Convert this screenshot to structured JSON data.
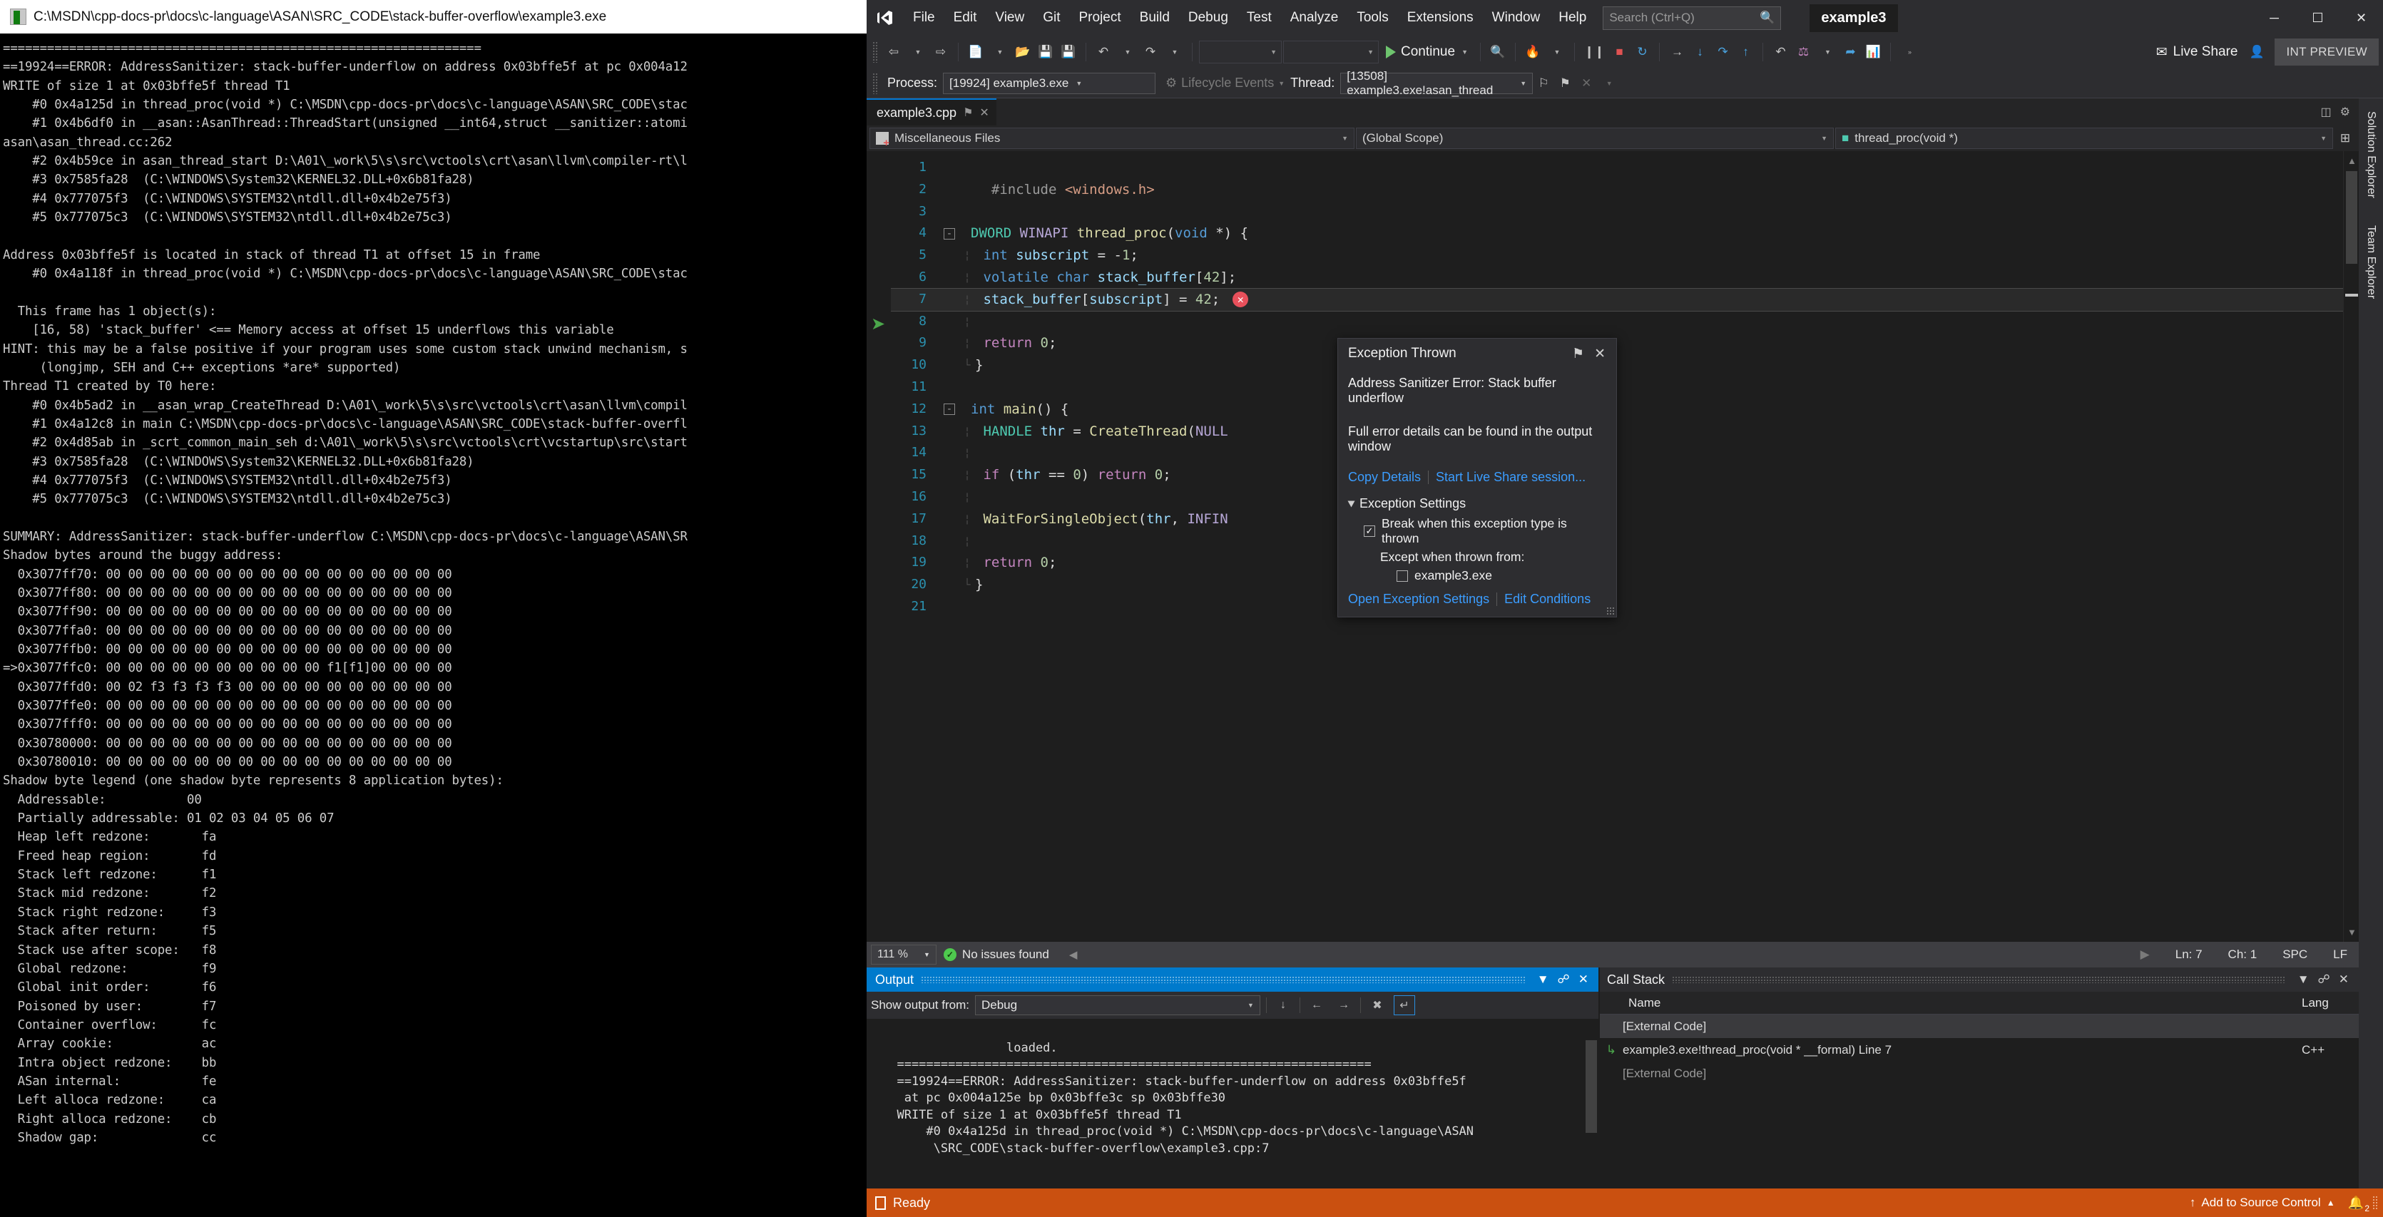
{
  "console": {
    "title": "C:\\MSDN\\cpp-docs-pr\\docs\\c-language\\ASAN\\SRC_CODE\\stack-buffer-overflow\\example3.exe",
    "text": "=================================================================\n==19924==ERROR: AddressSanitizer: stack-buffer-underflow on address 0x03bffe5f at pc 0x004a12\nWRITE of size 1 at 0x03bffe5f thread T1\n    #0 0x4a125d in thread_proc(void *) C:\\MSDN\\cpp-docs-pr\\docs\\c-language\\ASAN\\SRC_CODE\\stac\n    #1 0x4b6df0 in __asan::AsanThread::ThreadStart(unsigned __int64,struct __sanitizer::atomi\nasan\\asan_thread.cc:262\n    #2 0x4b59ce in asan_thread_start D:\\A01\\_work\\5\\s\\src\\vctools\\crt\\asan\\llvm\\compiler-rt\\l\n    #3 0x7585fa28  (C:\\WINDOWS\\System32\\KERNEL32.DLL+0x6b81fa28)\n    #4 0x777075f3  (C:\\WINDOWS\\SYSTEM32\\ntdll.dll+0x4b2e75f3)\n    #5 0x777075c3  (C:\\WINDOWS\\SYSTEM32\\ntdll.dll+0x4b2e75c3)\n\nAddress 0x03bffe5f is located in stack of thread T1 at offset 15 in frame\n    #0 0x4a118f in thread_proc(void *) C:\\MSDN\\cpp-docs-pr\\docs\\c-language\\ASAN\\SRC_CODE\\stac\n\n  This frame has 1 object(s):\n    [16, 58) 'stack_buffer' <== Memory access at offset 15 underflows this variable\nHINT: this may be a false positive if your program uses some custom stack unwind mechanism, s\n     (longjmp, SEH and C++ exceptions *are* supported)\nThread T1 created by T0 here:\n    #0 0x4b5ad2 in __asan_wrap_CreateThread D:\\A01\\_work\\5\\s\\src\\vctools\\crt\\asan\\llvm\\compil\n    #1 0x4a12c8 in main C:\\MSDN\\cpp-docs-pr\\docs\\c-language\\ASAN\\SRC_CODE\\stack-buffer-overfl\n    #2 0x4d85ab in _scrt_common_main_seh d:\\A01\\_work\\5\\s\\src\\vctools\\crt\\vcstartup\\src\\start\n    #3 0x7585fa28  (C:\\WINDOWS\\System32\\KERNEL32.DLL+0x6b81fa28)\n    #4 0x777075f3  (C:\\WINDOWS\\SYSTEM32\\ntdll.dll+0x4b2e75f3)\n    #5 0x777075c3  (C:\\WINDOWS\\SYSTEM32\\ntdll.dll+0x4b2e75c3)\n\nSUMMARY: AddressSanitizer: stack-buffer-underflow C:\\MSDN\\cpp-docs-pr\\docs\\c-language\\ASAN\\SR\nShadow bytes around the buggy address:\n  0x3077ff70: 00 00 00 00 00 00 00 00 00 00 00 00 00 00 00 00\n  0x3077ff80: 00 00 00 00 00 00 00 00 00 00 00 00 00 00 00 00\n  0x3077ff90: 00 00 00 00 00 00 00 00 00 00 00 00 00 00 00 00\n  0x3077ffa0: 00 00 00 00 00 00 00 00 00 00 00 00 00 00 00 00\n  0x3077ffb0: 00 00 00 00 00 00 00 00 00 00 00 00 00 00 00 00\n=>0x3077ffc0: 00 00 00 00 00 00 00 00 00 00 f1[f1]00 00 00 00\n  0x3077ffd0: 00 02 f3 f3 f3 f3 00 00 00 00 00 00 00 00 00 00\n  0x3077ffe0: 00 00 00 00 00 00 00 00 00 00 00 00 00 00 00 00\n  0x3077fff0: 00 00 00 00 00 00 00 00 00 00 00 00 00 00 00 00\n  0x30780000: 00 00 00 00 00 00 00 00 00 00 00 00 00 00 00 00\n  0x30780010: 00 00 00 00 00 00 00 00 00 00 00 00 00 00 00 00\nShadow byte legend (one shadow byte represents 8 application bytes):\n  Addressable:           00\n  Partially addressable: 01 02 03 04 05 06 07\n  Heap left redzone:       fa\n  Freed heap region:       fd\n  Stack left redzone:      f1\n  Stack mid redzone:       f2\n  Stack right redzone:     f3\n  Stack after return:      f5\n  Stack use after scope:   f8\n  Global redzone:          f9\n  Global init order:       f6\n  Poisoned by user:        f7\n  Container overflow:      fc\n  Array cookie:            ac\n  Intra object redzone:    bb\n  ASan internal:           fe\n  Left alloca redzone:     ca\n  Right alloca redzone:    cb\n  Shadow gap:              cc"
  },
  "vs": {
    "menus": [
      "File",
      "Edit",
      "View",
      "Git",
      "Project",
      "Build",
      "Debug",
      "Test",
      "Analyze",
      "Tools",
      "Extensions",
      "Window",
      "Help"
    ],
    "search_placeholder": "Search (Ctrl+Q)",
    "doc_title": "example3",
    "window_controls": {
      "minimize": "─",
      "maximize": "☐",
      "close": "✕"
    },
    "toolbar": {
      "continue_label": "Continue",
      "live_share_label": "Live Share",
      "int_preview_label": "INT PREVIEW",
      "combo1": "",
      "combo2": ""
    },
    "processbar": {
      "process_label": "Process:",
      "process_value": "[19924] example3.exe",
      "lifecycle_label": "Lifecycle Events",
      "thread_label": "Thread:",
      "thread_value": "[13508] example3.exe!asan_thread"
    },
    "tab": {
      "label": "example3.cpp",
      "pin": "⚑",
      "close": "✕"
    },
    "navbar": {
      "project": "Miscellaneous Files",
      "scope": "(Global Scope)",
      "member": "thread_proc(void *)"
    },
    "editor": {
      "lines": [
        {
          "n": "1",
          "fold": "",
          "indent": "",
          "html": ""
        },
        {
          "n": "2",
          "fold": "",
          "indent": "",
          "html": "  <span class='ppd'>#include</span> <span class='str'>&lt;windows.h&gt;</span>"
        },
        {
          "n": "3",
          "fold": "",
          "indent": "",
          "html": ""
        },
        {
          "n": "4",
          "fold": "-",
          "indent": "",
          "html": "<span class='typ'>DWORD</span> <span class='mac'>WINAPI</span> <span class='fn'>thread_proc</span>(<span class='kw'>void</span> *) {"
        },
        {
          "n": "5",
          "fold": "",
          "indent": "¦",
          "html": " <span class='kw'>int</span> <span class='var'>subscript</span> = -<span class='num'>1</span>;"
        },
        {
          "n": "6",
          "fold": "",
          "indent": "¦",
          "html": " <span class='kw'>volatile</span> <span class='kw'>char</span> <span class='var'>stack_buffer</span>[<span class='num'>42</span>];"
        },
        {
          "n": "7",
          "fold": "",
          "indent": "¦",
          "html": " <span class='var'>stack_buffer</span>[<span class='var'>subscript</span>] = <span class='num'>42</span>;",
          "current": true,
          "error": "✕"
        },
        {
          "n": "8",
          "fold": "",
          "indent": "¦",
          "html": ""
        },
        {
          "n": "9",
          "fold": "",
          "indent": "¦",
          "html": " <span class='kw2'>return</span> <span class='num'>0</span>;"
        },
        {
          "n": "10",
          "fold": "",
          "indent": "└",
          "html": "}"
        },
        {
          "n": "11",
          "fold": "",
          "indent": "",
          "html": ""
        },
        {
          "n": "12",
          "fold": "-",
          "indent": "",
          "html": "<span class='kw'>int</span> <span class='fn'>main</span>() {"
        },
        {
          "n": "13",
          "fold": "",
          "indent": "¦",
          "html": " <span class='typ'>HANDLE</span> <span class='var'>thr</span> = <span class='fn'>CreateThread</span>(<span class='mac'>NULL</span>"
        },
        {
          "n": "14",
          "fold": "",
          "indent": "¦",
          "html": ""
        },
        {
          "n": "15",
          "fold": "",
          "indent": "¦",
          "html": " <span class='kw2'>if</span> (<span class='var'>thr</span> == <span class='num'>0</span>) <span class='kw2'>return</span> <span class='num'>0</span>;"
        },
        {
          "n": "16",
          "fold": "",
          "indent": "¦",
          "html": ""
        },
        {
          "n": "17",
          "fold": "",
          "indent": "¦",
          "html": " <span class='fn'>WaitForSingleObject</span>(<span class='var'>thr</span>, <span class='mac'>INFIN</span>"
        },
        {
          "n": "18",
          "fold": "",
          "indent": "¦",
          "html": ""
        },
        {
          "n": "19",
          "fold": "",
          "indent": "¦",
          "html": " <span class='kw2'>return</span> <span class='num'>0</span>;"
        },
        {
          "n": "20",
          "fold": "",
          "indent": "└",
          "html": "}"
        },
        {
          "n": "21",
          "fold": "",
          "indent": "",
          "html": ""
        }
      ]
    },
    "exception_popup": {
      "title": "Exception Thrown",
      "pin_icon": "⚑",
      "close_icon": "✕",
      "message": "Address Sanitizer Error: Stack buffer underflow",
      "message2": "Full error details can be found in the output window",
      "copy_details": "Copy Details",
      "live_share": "Start Live Share session...",
      "settings_header": "Exception Settings",
      "break_label": "Break when this exception type is thrown",
      "break_checked": "✓",
      "except_label": "Except when thrown from:",
      "exe_label": "example3.exe",
      "exe_checked": "",
      "open_settings": "Open Exception Settings",
      "edit_conditions": "Edit Conditions"
    },
    "editor_status": {
      "zoom": "111 %",
      "issues": "No issues found",
      "ln": "Ln: 7",
      "ch": "Ch: 1",
      "spc": "SPC",
      "eol": "LF"
    },
    "output": {
      "title": "Output",
      "show_from_label": "Show output from:",
      "show_from_value": "Debug",
      "text": "   loaded.\n  =================================================================\n  ==19924==ERROR: AddressSanitizer: stack-buffer-underflow on address 0x03bffe5f\n   at pc 0x004a125e bp 0x03bffe3c sp 0x03bffe30\n  WRITE of size 1 at 0x03bffe5f thread T1\n      #0 0x4a125d in thread_proc(void *) C:\\MSDN\\cpp-docs-pr\\docs\\c-language\\ASAN\n       \\SRC_CODE\\stack-buffer-overflow\\example3.cpp:7"
    },
    "callstack": {
      "title": "Call Stack",
      "columns": [
        "Name",
        "Lang"
      ],
      "rows": [
        {
          "marker": "",
          "name": "[External Code]",
          "lang": "",
          "selected": true,
          "dim": false
        },
        {
          "marker": "↳",
          "name": "example3.exe!thread_proc(void * __formal) Line 7",
          "lang": "C++",
          "selected": false,
          "dim": false
        },
        {
          "marker": "",
          "name": "[External Code]",
          "lang": "",
          "selected": false,
          "dim": true
        }
      ]
    },
    "right_rail": [
      "Solution Explorer",
      "Team Explorer"
    ],
    "statusbar": {
      "ready": "Ready",
      "source_control": "Add to Source Control",
      "caret": "▲",
      "notify_count": "2"
    }
  }
}
